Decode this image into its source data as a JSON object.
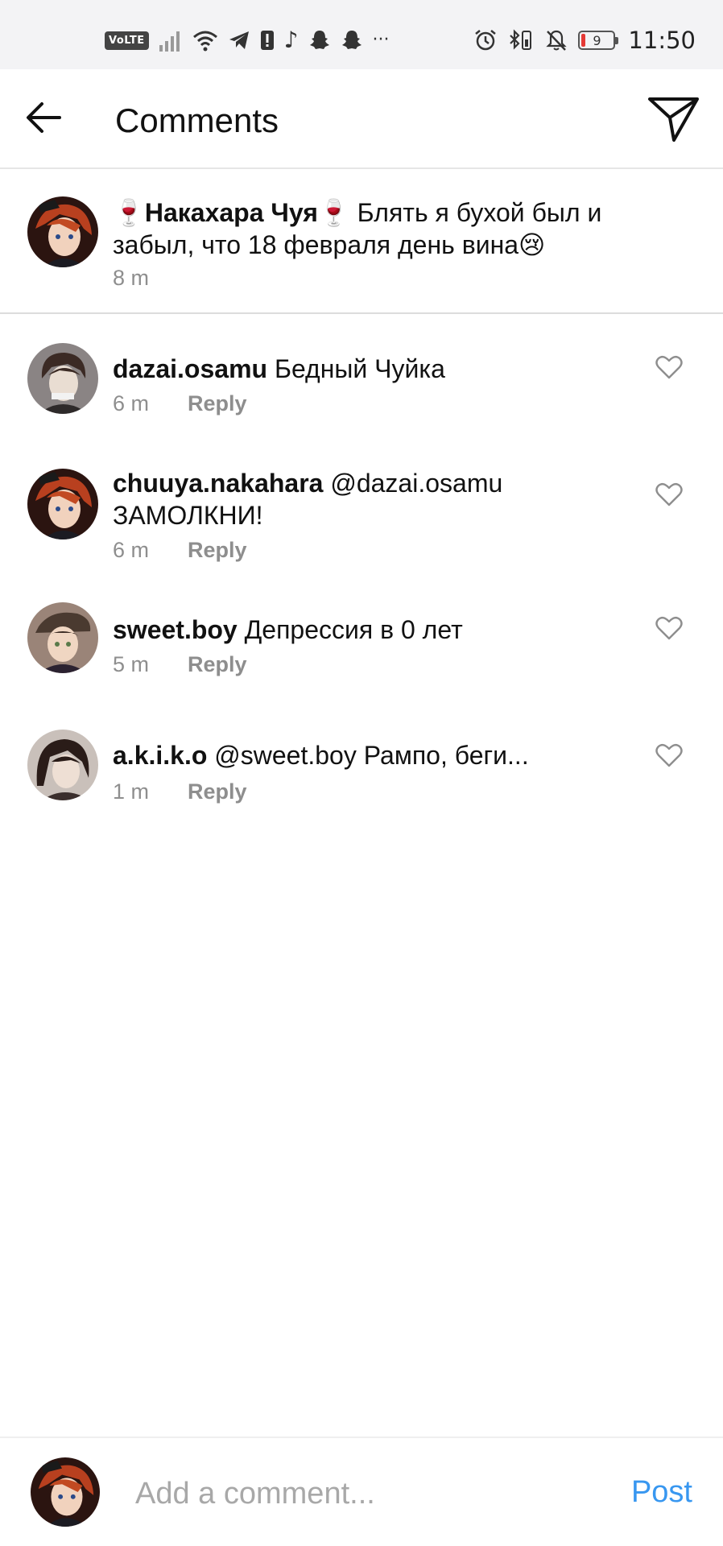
{
  "status_bar": {
    "volte": "VoLTE",
    "battery_level": "9",
    "time": "11:50",
    "more": "···"
  },
  "header": {
    "title": "Comments"
  },
  "caption": {
    "username": "🍷Накахара Чуя🍷",
    "text": " Блять я бухой был и забыл, что 18 февраля день вина😢",
    "time": "8 m"
  },
  "comments": [
    {
      "username": "dazai.osamu",
      "text": " Бедный Чуйка",
      "time": "6 m",
      "reply": "Reply"
    },
    {
      "username": "chuuya.nakahara",
      "text": " @dazai.osamu ЗАМОЛКНИ!",
      "time": "6 m",
      "reply": "Reply"
    },
    {
      "username": "sweet.boy",
      "text": " Депрессия в 0 лет",
      "time": "5 m",
      "reply": "Reply"
    },
    {
      "username": "a.k.i.k.o",
      "text": " @sweet.boy Рампо, беги...",
      "time": "1 m",
      "reply": "Reply"
    }
  ],
  "composer": {
    "placeholder": "Add a comment...",
    "post_label": "Post"
  },
  "colors": {
    "post_blue": "#3897f0",
    "meta_gray": "#8e8e8e",
    "status_bg": "#f3f3f5"
  }
}
